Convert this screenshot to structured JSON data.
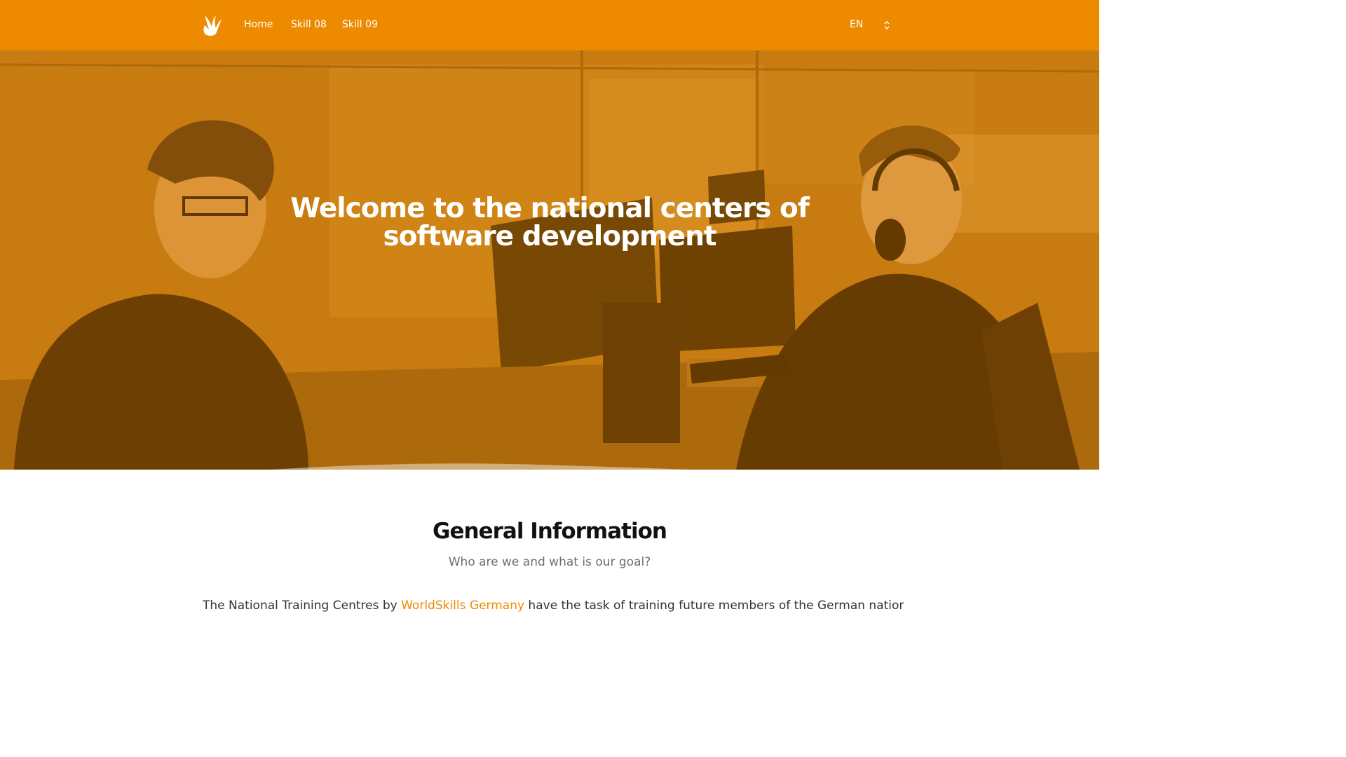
{
  "header": {
    "nav": [
      {
        "label": "Home"
      },
      {
        "label": "Skill 08"
      },
      {
        "label": "Skill 09"
      }
    ],
    "language": "EN"
  },
  "hero": {
    "title": "Welcome to the national centers of software development"
  },
  "general_info": {
    "title": "General Information",
    "subtitle": "Who are we and what is our goal?",
    "paragraph_before": "The National Training Centres by ",
    "link_text": "WorldSkills Germany",
    "paragraph_after": " have the task of training future members of the German national"
  },
  "colors": {
    "brand": "#ee8a00",
    "text": "#222222",
    "muted": "#6b6f75"
  }
}
